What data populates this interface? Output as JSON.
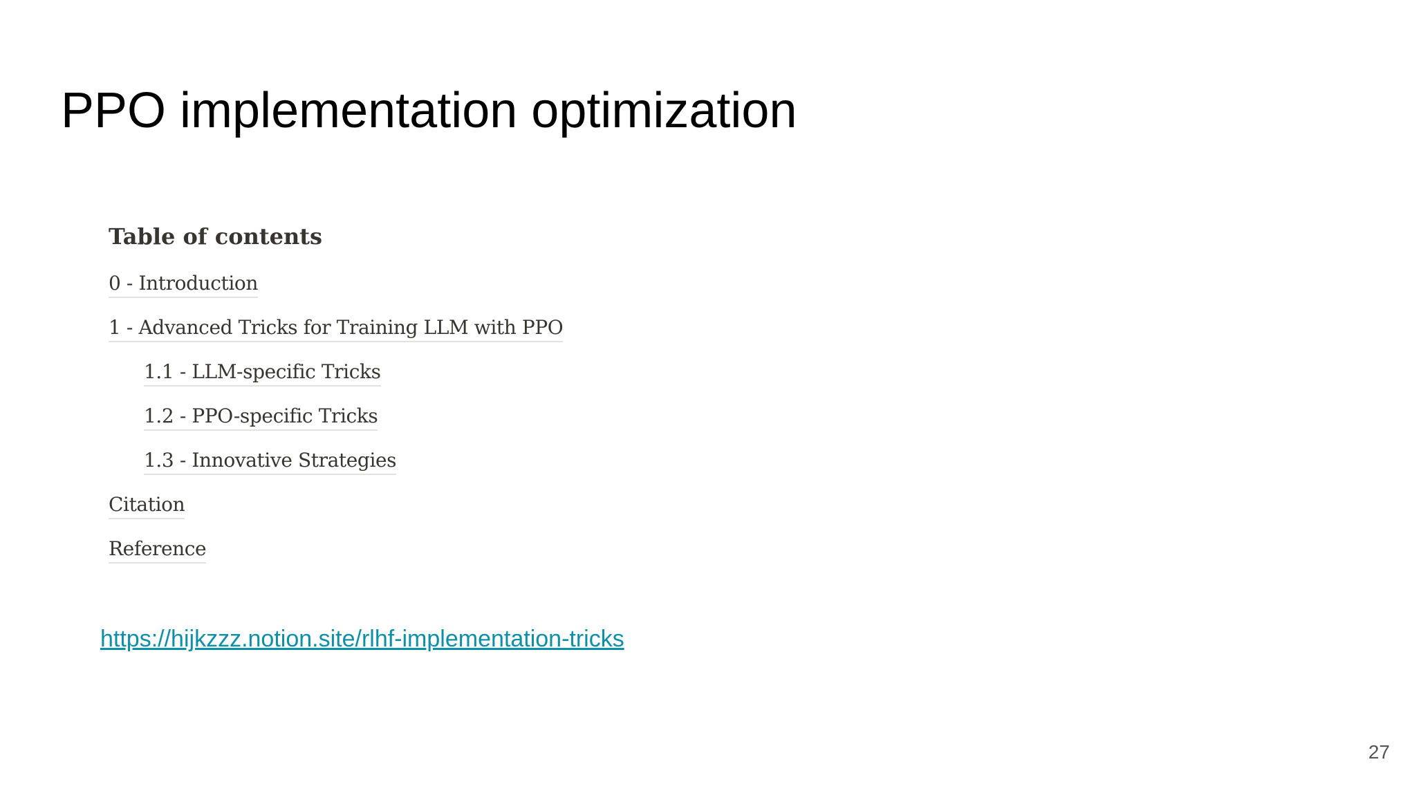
{
  "slide": {
    "title": "PPO implementation optimization",
    "page_number": "27"
  },
  "toc": {
    "heading": "Table of contents",
    "items": [
      {
        "label": "0 - Introduction",
        "level": 1
      },
      {
        "label": "1 - Advanced Tricks for Training LLM with PPO",
        "level": 1
      },
      {
        "label": "1.1 - LLM-specific Tricks",
        "level": 2
      },
      {
        "label": "1.2 - PPO-specific Tricks",
        "level": 2
      },
      {
        "label": "1.3 - Innovative Strategies",
        "level": 2
      },
      {
        "label": "Citation",
        "level": 1
      },
      {
        "label": "Reference",
        "level": 1
      }
    ]
  },
  "source": {
    "url_text": "https://hijkzzz.notion.site/rlhf-implementation-tricks"
  },
  "colors": {
    "link": "#0e8fa8",
    "toc_text": "#37352f",
    "toc_underline": "#e3e2e0"
  }
}
